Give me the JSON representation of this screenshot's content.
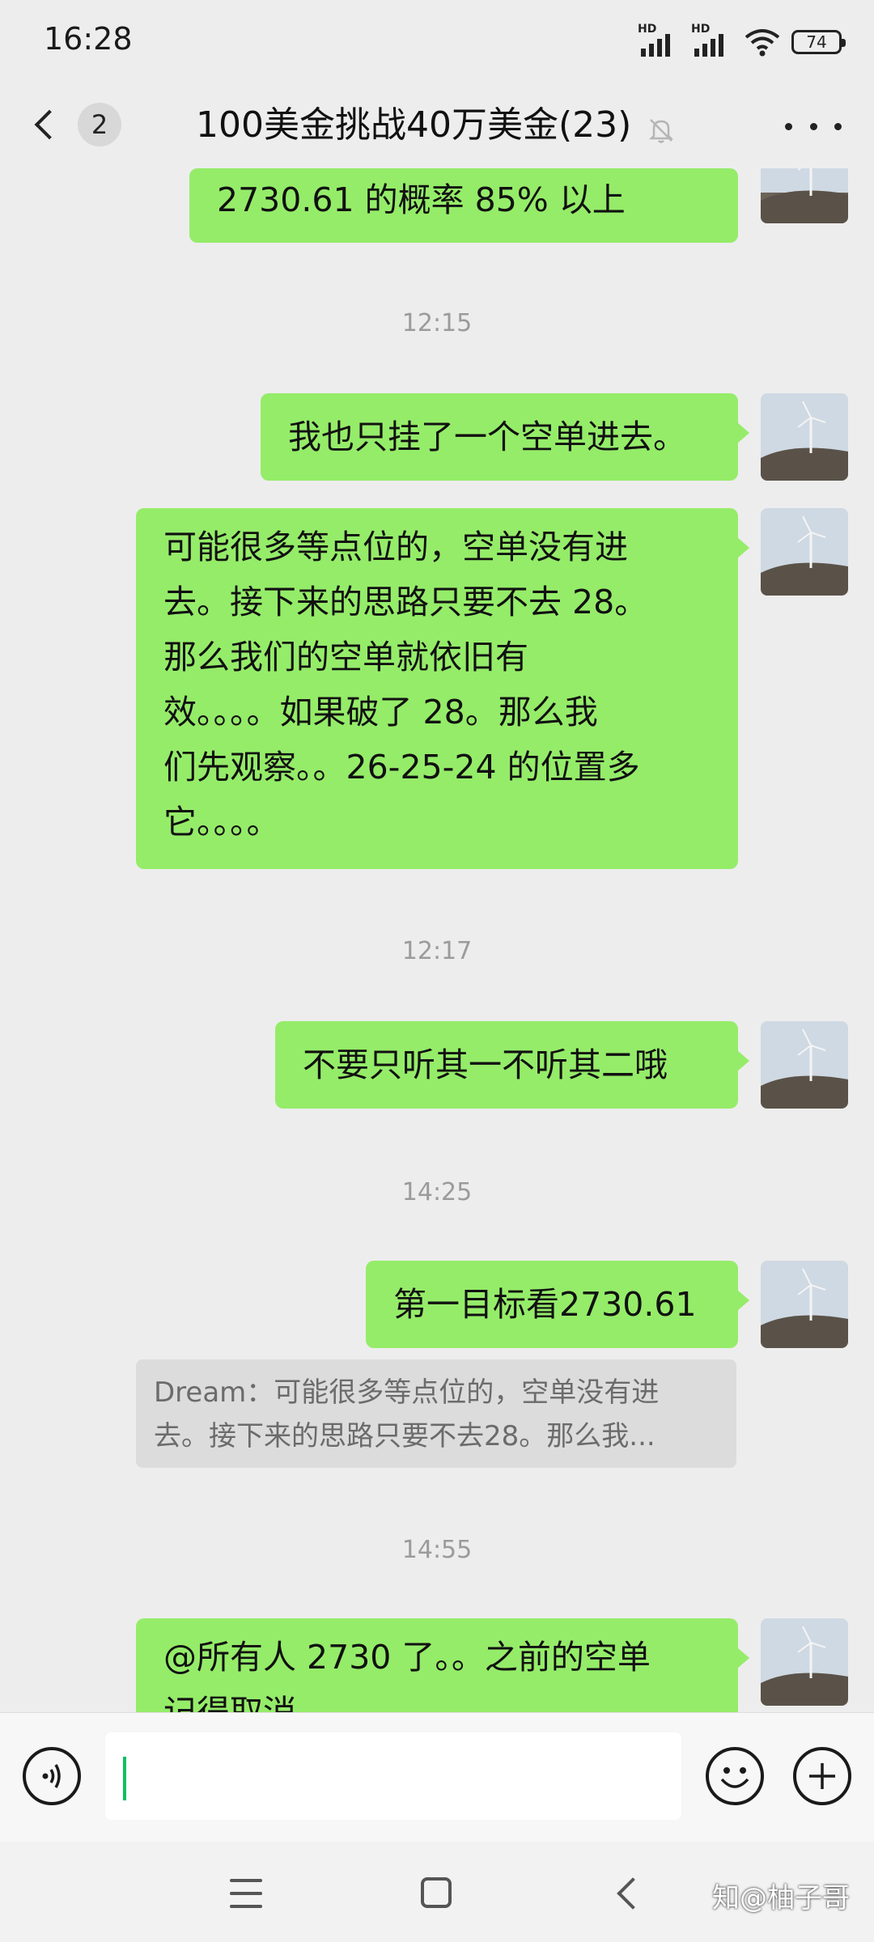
{
  "status_bar": {
    "time": "16:28",
    "signal1_label": "HD",
    "signal2_label": "HD",
    "battery": "74"
  },
  "header": {
    "back_count": "2",
    "title": "100美金挑战40万美金(23)",
    "mute_icon": "bell-off-icon",
    "more_icon": "more-icon"
  },
  "messages": {
    "m0": {
      "text": "2730.61 的概率 85% 以上"
    },
    "t1": "12:15",
    "m1": {
      "text": "我也只挂了一个空单进去。"
    },
    "m2": {
      "lines": [
        "可能很多等点位的，空单没有进",
        "去。接下来的思路只要不去 28。",
        "那么我们的空单就依旧有",
        "效。。。。如果破了 28。那么我",
        "们先观察。。26-25-24 的位置多",
        "它。。。。"
      ]
    },
    "t2": "12:17",
    "m3": {
      "text": "不要只听其一不听其二哦"
    },
    "t3": "14:25",
    "m4": {
      "text": "第一目标看2730.61"
    },
    "quote": {
      "line1": "Dream：可能很多等点位的，空单没有进",
      "line2": "去。接下来的思路只要不去28。那么我..."
    },
    "t4": "14:55",
    "m5": {
      "line1": "@所有人  2730 了。。之前的空单",
      "line2": "记得取消"
    }
  },
  "input": {
    "placeholder": ""
  },
  "watermark": "知@柚子哥",
  "colors": {
    "bubble": "#95ec69",
    "background": "#ededed",
    "caret": "#07c160"
  }
}
